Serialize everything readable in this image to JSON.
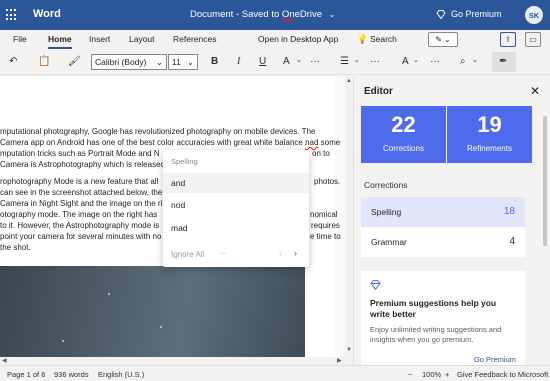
{
  "titlebar": {
    "app_name": "Word",
    "doc_title": "Document",
    "separator": "-",
    "save_status": "Saved to OneDrive",
    "chevron": "⌄",
    "premium_label": "Go Premium",
    "premium_icon": "diamond-icon",
    "avatar_initials": "SK"
  },
  "ribbon": {
    "tabs": [
      "File",
      "Home",
      "Insert",
      "Layout",
      "References",
      "Open in Desktop App",
      "Search"
    ],
    "active_tab": "Home",
    "pen_icon": "✎",
    "share_icon": "⇪",
    "comment_icon": "▭"
  },
  "toolbar": {
    "undo_icon": "↶",
    "clipboard_icon": "📋",
    "format_painter_icon": "🖌",
    "font_name": "Calibri (Body)",
    "font_size": "11",
    "bold": "B",
    "italic": "I",
    "underline": "U",
    "font_color": "A",
    "more": "···",
    "bullets_icon": "☰",
    "styles": "A",
    "find_icon": "⌕",
    "editor_icon": "✒"
  },
  "document": {
    "lines": [
      "mputational photography, Google has revolutionized photography on mobile devices. The",
      "Camera app on Android has one of the best color accuracies with great white balance nad some",
      "mputation tricks such as Portrait Mode and N",
      "Camera is Astrophotography which is releasec",
      "rophotography Mode is a new feature that all",
      "can see in the screenshot attached below, the",
      "Camera in Night Sight and the image on the ri",
      "otography mode. The image on the right has",
      "to it. However, the Astrophotography mode is",
      "point your camera for several minutes with no",
      " the shot."
    ],
    "lines_right": [
      "",
      "",
      "on to",
      "",
      "photos.",
      "",
      "",
      "nomical",
      "requires",
      "e time to",
      ""
    ]
  },
  "spelling_popup": {
    "heading": "Spelling",
    "suggestions": [
      "and",
      "nod",
      "mad"
    ],
    "ignore_all": "Ignore All",
    "more": "···",
    "prev": "‹",
    "next": "›"
  },
  "editor": {
    "title": "Editor",
    "close": "✕",
    "corrections_count": "22",
    "corrections_label": "Corrections",
    "refinements_count": "19",
    "refinements_label": "Refinements",
    "section_label": "Corrections",
    "categories": [
      {
        "label": "Spelling",
        "count": "18"
      },
      {
        "label": "Grammar",
        "count": "4"
      }
    ],
    "premium_card": {
      "heading": "Premium suggestions help you write better",
      "body": "Enjoy unlimited writing suggestions and insights when you go premium.",
      "link": "Go Premium"
    },
    "accent_color": "#4f6bed"
  },
  "statusbar": {
    "page": "Page 1 of 6",
    "words": "936 words",
    "language": "English (U.S.)",
    "zoom_minus": "−",
    "zoom": "100%",
    "zoom_plus": "+",
    "feedback": "Give Feedback to Microsoft"
  },
  "colors": {
    "brand": "#2b579a",
    "spell_error": "#e81123"
  }
}
